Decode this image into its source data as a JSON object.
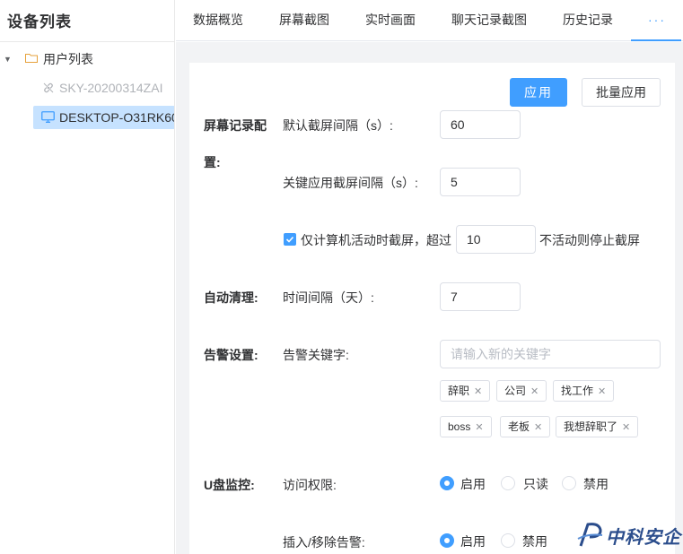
{
  "sidebar": {
    "title": "设备列表",
    "tree": {
      "root_label": "用户列表",
      "children": [
        {
          "label": "SKY-20200314ZAI",
          "status": "offline",
          "icon": "link-icon"
        },
        {
          "label": "DESKTOP-O31RK60",
          "status": "selected",
          "icon": "monitor-icon"
        }
      ]
    }
  },
  "tabs": [
    {
      "label": "数据概览"
    },
    {
      "label": "屏幕截图"
    },
    {
      "label": "实时画面"
    },
    {
      "label": "聊天记录截图"
    },
    {
      "label": "历史记录"
    },
    {
      "label": "···"
    }
  ],
  "actions": {
    "apply": "应用",
    "batch_apply": "批量应用"
  },
  "screen_record": {
    "section_label_line1": "屏幕记录配",
    "section_label_line2": "置:",
    "default_interval_label": "默认截屏间隔（s）:",
    "default_interval_value": "60",
    "key_app_interval_label": "关键应用截屏间隔（s）:",
    "key_app_interval_value": "5",
    "active_only_checked": true,
    "active_only_label": "仅计算机活动时截屏，超过",
    "inactive_value": "10",
    "inactive_suffix": "不活动则停止截屏"
  },
  "auto_clean": {
    "section_label": "自动清理:",
    "interval_label": "时间间隔（天）:",
    "interval_value": "7"
  },
  "alert": {
    "section_label": "告警设置:",
    "keyword_label": "告警关键字:",
    "keyword_placeholder": "请输入新的关键字",
    "keywords": [
      "辞职",
      "公司",
      "找工作",
      "boss",
      "老板",
      "我想辞职了"
    ]
  },
  "usb": {
    "section_label": "U盘监控:",
    "access_label": "访问权限:",
    "access_options": [
      "启用",
      "只读",
      "禁用"
    ],
    "access_selected": "启用",
    "plug_alert_label": "插入/移除告警:",
    "plug_options": [
      "启用",
      "禁用"
    ],
    "plug_selected": "启用"
  },
  "watermark": {
    "text": "中科安企"
  },
  "colors": {
    "accent": "#409eff",
    "selected_row": "#c6e2ff",
    "panel_bg": "#f2f3f5",
    "watermark": "#2b4d8c"
  }
}
